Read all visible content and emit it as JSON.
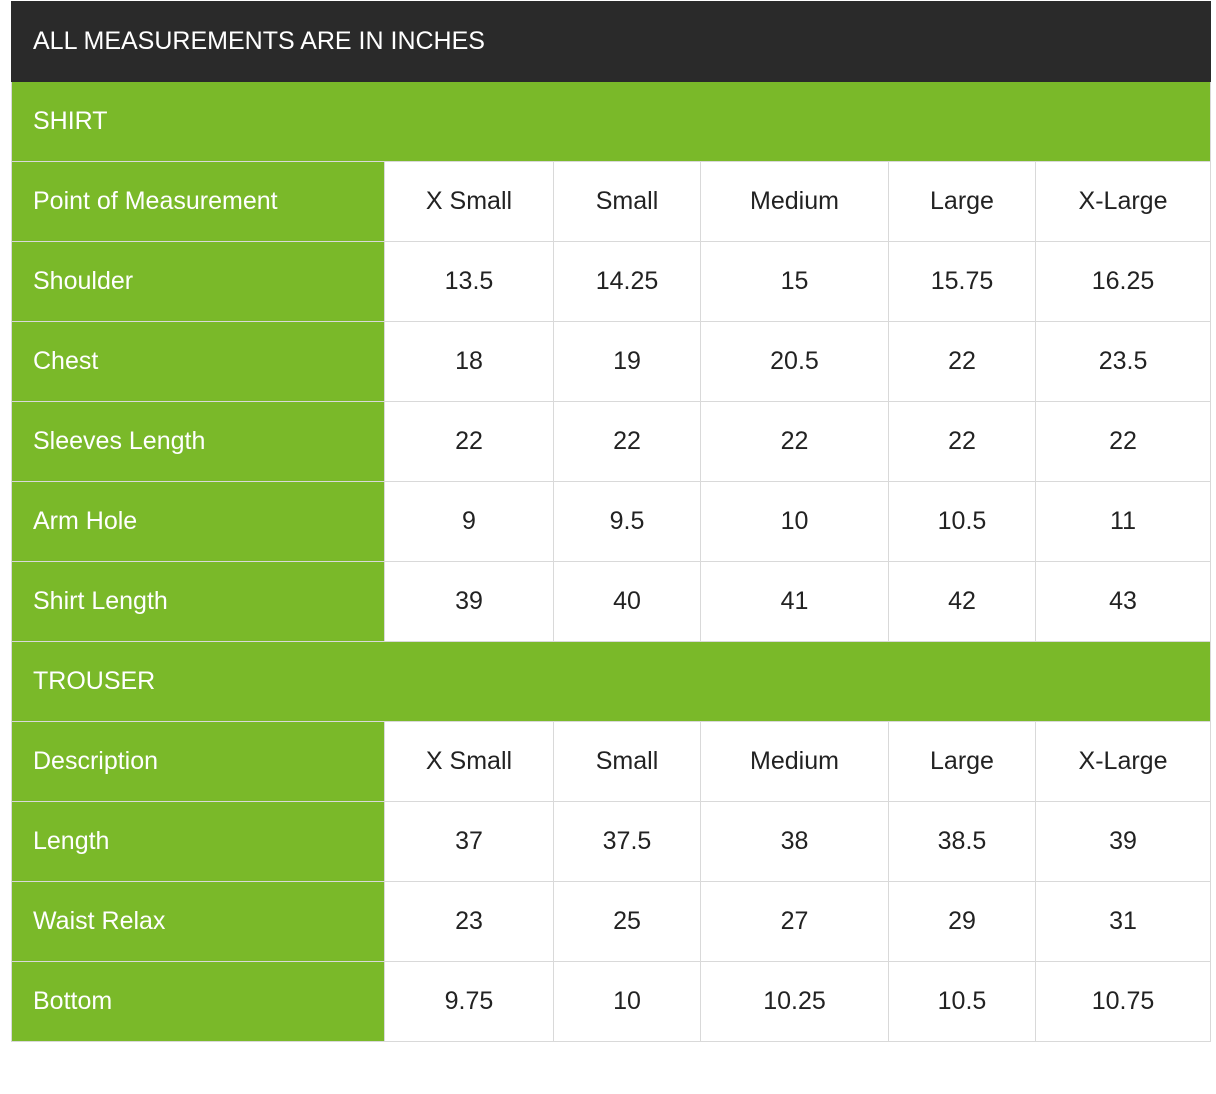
{
  "title": "ALL MEASUREMENTS ARE IN INCHES",
  "colors": {
    "green": "#7ab929",
    "dark": "#2a2a2a",
    "border": "#d9d9d9"
  },
  "shirt": {
    "section": "SHIRT",
    "header": [
      "Point of Measurement",
      "X Small",
      "Small",
      "Medium",
      "Large",
      "X-Large"
    ],
    "rows": [
      [
        "Shoulder",
        "13.5",
        "14.25",
        "15",
        "15.75",
        "16.25"
      ],
      [
        "Chest",
        "18",
        "19",
        "20.5",
        "22",
        "23.5"
      ],
      [
        "Sleeves Length",
        "22",
        "22",
        "22",
        "22",
        "22"
      ],
      [
        "Arm Hole",
        "9",
        "9.5",
        "10",
        "10.5",
        "11"
      ],
      [
        "Shirt Length",
        "39",
        "40",
        "41",
        "42",
        "43"
      ]
    ]
  },
  "trouser": {
    "section": "TROUSER",
    "header": [
      "Description",
      "X Small",
      "Small",
      "Medium",
      "Large",
      "X-Large"
    ],
    "rows": [
      [
        "Length",
        "37",
        "37.5",
        "38",
        "38.5",
        "39"
      ],
      [
        "Waist Relax",
        "23",
        "25",
        "27",
        "29",
        "31"
      ],
      [
        "Bottom",
        "9.75",
        "10",
        "10.25",
        "10.5",
        "10.75"
      ]
    ]
  }
}
